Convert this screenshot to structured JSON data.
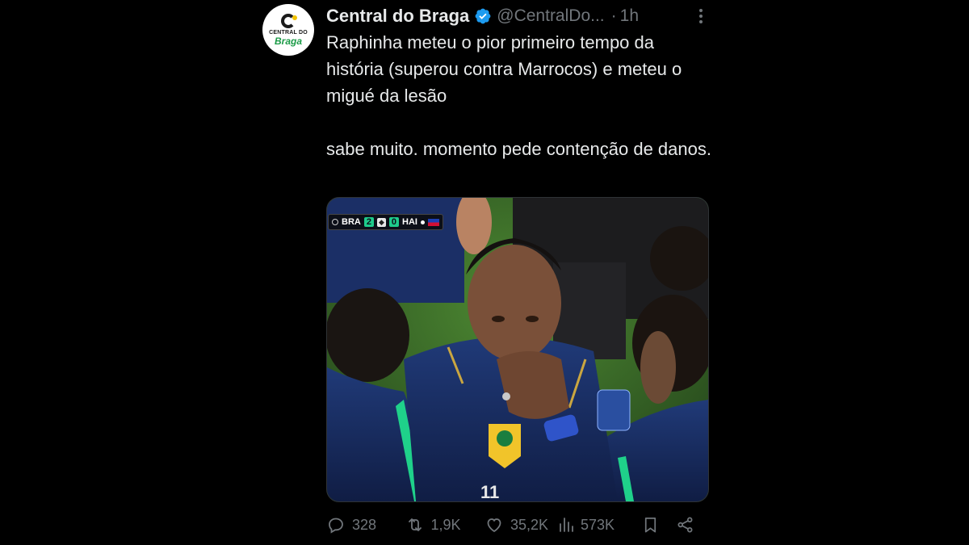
{
  "account": {
    "name": "Central do Braga",
    "handle": "@CentralDo...",
    "time": "1h",
    "dot": "·",
    "avatar": {
      "line1": "CENTRAL DO",
      "line2": "Braga"
    },
    "verified": true
  },
  "tweet": {
    "paragraph1": "Raphinha meteu o pior primeiro tempo da história (superou contra Marrocos) e meteu o migué da lesão",
    "paragraph2": "sabe muito. momento pede contenção de danos."
  },
  "media": {
    "scorebug": {
      "home": "BRA",
      "home_score": "2",
      "away_score": "0",
      "away": "HAI"
    }
  },
  "actions": {
    "replies": "328",
    "retweets": "1,9K",
    "likes": "35,2K",
    "views": "573K"
  },
  "colors": {
    "background": "#000000",
    "text": "#e7e9ea",
    "muted": "#71767b",
    "verified": "#1d9bf0",
    "brand_green": "#1b9b47"
  }
}
